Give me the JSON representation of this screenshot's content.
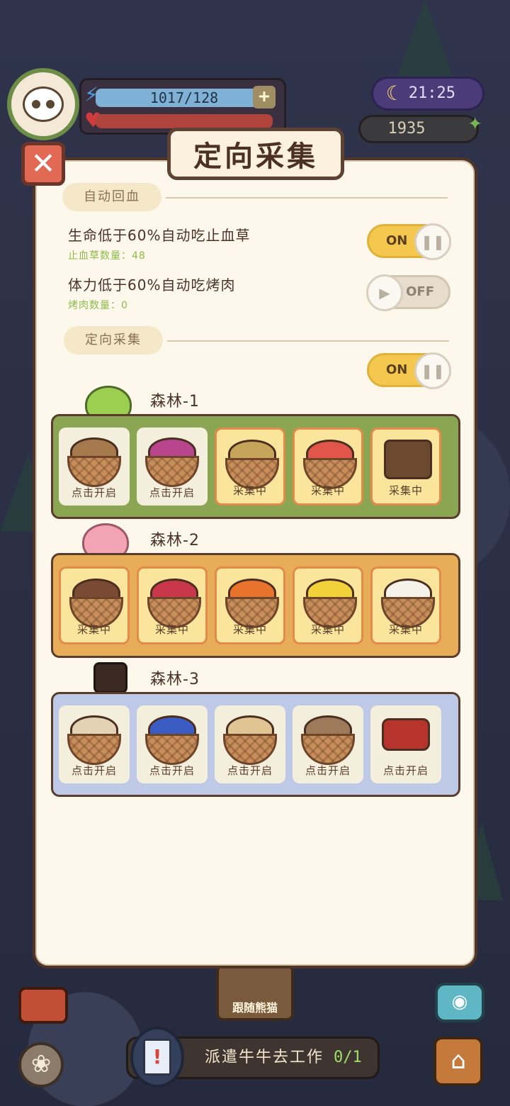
{
  "hud": {
    "energy": "1017/128",
    "energy_plus": "+",
    "clock": "21:25",
    "coins": "1935"
  },
  "modal": {
    "title": "定向采集",
    "close_glyph": "✕"
  },
  "auto_heal": {
    "tag": "自动回血",
    "hp_setting": "生命低于60%自动吃止血草",
    "hp_item_count": "止血草数量：48",
    "hp_toggle": "ON",
    "stamina_setting": "体力低于60%自动吃烤肉",
    "stamina_item_count": "烤肉数量：0",
    "stamina_toggle": "OFF"
  },
  "directed": {
    "tag": "定向采集",
    "toggle": "ON"
  },
  "forests": [
    {
      "name": "森林-1",
      "slots": [
        {
          "status": "点击开启",
          "state": "locked",
          "item_color": "#a67a4d"
        },
        {
          "status": "点击开启",
          "state": "locked",
          "item_color": "#b8458e"
        },
        {
          "status": "采集中",
          "state": "collecting",
          "item_color": "#c6a55a"
        },
        {
          "status": "采集中",
          "state": "collecting",
          "item_color": "#e2554a"
        },
        {
          "status": "采集中",
          "state": "collecting",
          "item_color": "#6b4a30"
        }
      ]
    },
    {
      "name": "森林-2",
      "slots": [
        {
          "status": "采集中",
          "state": "collecting",
          "item_color": "#7a4a33"
        },
        {
          "status": "采集中",
          "state": "collecting",
          "item_color": "#c8384a"
        },
        {
          "status": "采集中",
          "state": "collecting",
          "item_color": "#e8732c"
        },
        {
          "status": "采集中",
          "state": "collecting",
          "item_color": "#f2d23a"
        },
        {
          "status": "采集中",
          "state": "collecting",
          "item_color": "#f5f2ea"
        }
      ]
    },
    {
      "name": "森林-3",
      "slots": [
        {
          "status": "点击开启",
          "state": "locked",
          "item_color": "#e3d2b4"
        },
        {
          "status": "点击开启",
          "state": "locked",
          "item_color": "#3b5cc2"
        },
        {
          "status": "点击开启",
          "state": "locked",
          "item_color": "#e0c491"
        },
        {
          "status": "点击开启",
          "state": "locked",
          "item_color": "#9c7a5a"
        },
        {
          "status": "点击开启",
          "state": "locked",
          "item_color": "#b7342c"
        }
      ]
    }
  ],
  "bottom": {
    "follow_panda": "跟随熊猫",
    "dispatch": "派遣牛牛去工作",
    "dispatch_count": "0/1"
  },
  "colors": {
    "forest1_bg": "#8ba653",
    "forest2_bg": "#e8ad58",
    "forest3_bg": "#bdc9e6",
    "toggle_on": "#f4c84f",
    "close_red": "#e26a55"
  }
}
